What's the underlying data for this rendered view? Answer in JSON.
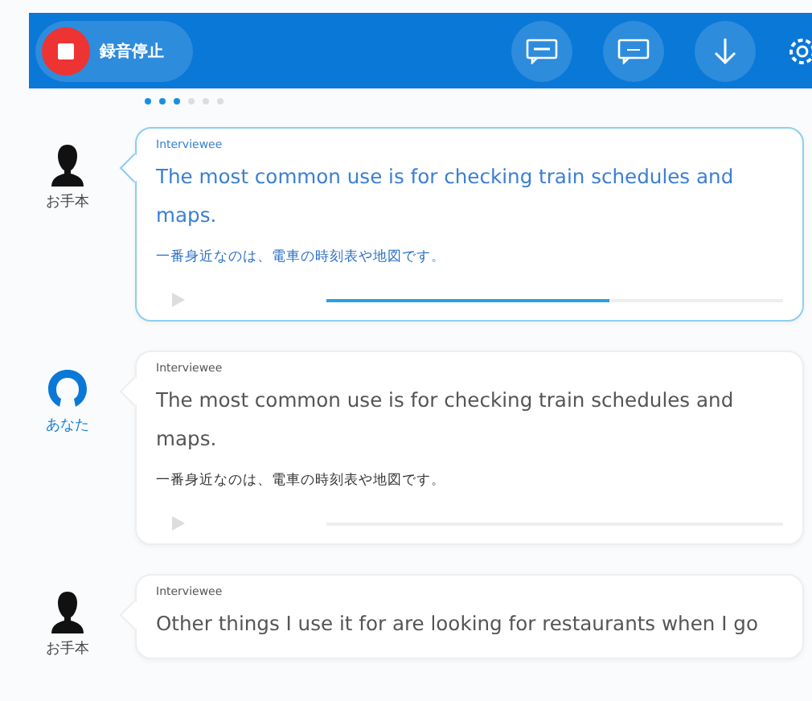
{
  "toolbar": {
    "record_button": {
      "label": "録音停止",
      "recording": true
    }
  },
  "pager": [
    {
      "selected": true
    },
    {
      "selected": true
    },
    {
      "selected": true
    },
    {
      "selected": false
    },
    {
      "selected": false
    },
    {
      "selected": false
    }
  ],
  "messages": [
    {
      "kind": "model",
      "speaker": "お手本",
      "role": "Interviewee",
      "text": "The most common use is for checking train schedules and maps.",
      "translation": "一番身近なのは、電車の時刻表や地図です。",
      "selected": true,
      "player": true,
      "level": 0.62
    },
    {
      "kind": "user",
      "speaker": "あなた",
      "role": "Interviewee",
      "text": "The most common use is for checking train schedules and maps.",
      "translation": "一番身近なのは、電車の時刻表や地図です。",
      "selected": false,
      "player": true
    },
    {
      "kind": "model",
      "speaker": "お手本",
      "role": "Interviewee",
      "text": "Other things I use it for are looking for restaurants when I go",
      "selected": false
    }
  ]
}
